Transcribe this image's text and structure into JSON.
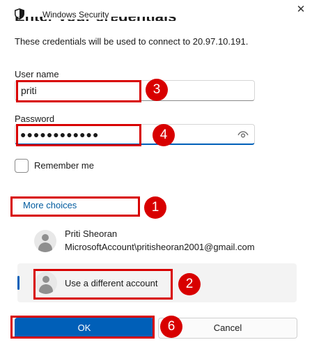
{
  "window": {
    "title": "Windows Security",
    "close_glyph": "✕",
    "heading": "Enter your credentials"
  },
  "subtitle": "These credentials will be used to connect to 20.97.10.191.",
  "username": {
    "label": "User name",
    "value": "priti"
  },
  "password": {
    "label": "Password",
    "masked_value": "●●●●●●●●●●●●",
    "reveal_icon": "eye-icon"
  },
  "remember": {
    "label": "Remember me",
    "checked": false
  },
  "more_choices": "More choices",
  "accounts": [
    {
      "name": "Priti Sheoran",
      "detail": "MicrosoftAccount\\pritisheoran2001@gmail.com"
    },
    {
      "name": "Use a different account"
    }
  ],
  "buttons": {
    "ok": "OK",
    "cancel": "Cancel"
  },
  "annotations": {
    "color": "#d80000",
    "steps": [
      "1",
      "2",
      "3",
      "4",
      "6"
    ]
  }
}
